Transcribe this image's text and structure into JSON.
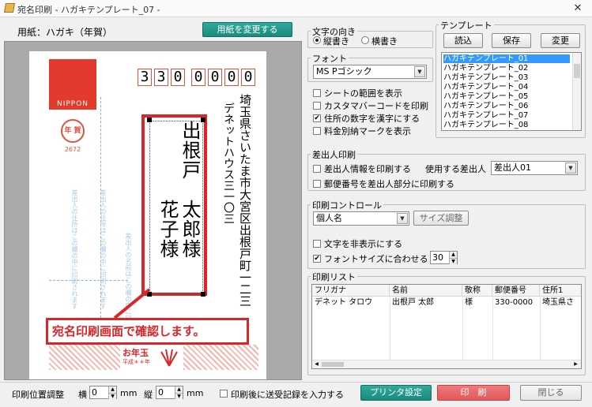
{
  "window": {
    "title": "宛名印刷 - ハガキテンプレート_07 -",
    "close": "✕"
  },
  "paper": {
    "label": "用紙：ハガキ（年賀）",
    "change_btn": "用紙を変更する"
  },
  "card": {
    "brand": "NIPPON",
    "stamp_text": "年 賀",
    "stamp_num": "2672",
    "postal_code": [
      "3",
      "3",
      "0",
      "0",
      "0",
      "0",
      "0"
    ],
    "addr_line1": "埼玉県さいたま市大宮区出根戸町一二三",
    "addr_line2": "デネットハウス三一〇三",
    "name_line1": "出根戸　太郎様",
    "name_line2": "　　　　花子様",
    "faded1": "差出人の住所はこの欄の中に印刷されます",
    "faded2": "差出人の住所はこの欄の中に印刷されます",
    "faded3": "差出人の名前はこの欄の中に印刷されます",
    "callout": "宛名印刷画面で確認します。",
    "otoshidama": "お年玉",
    "otoshidama_sub": "平成＊＊年"
  },
  "direction": {
    "title": "文字の向き",
    "vertical": "縦書き",
    "horizontal": "横書き"
  },
  "font": {
    "title": "フォント",
    "value": "MS Pゴシック"
  },
  "options": [
    {
      "label": "シートの範囲を表示",
      "checked": ""
    },
    {
      "label": "カスタマバーコードを印刷",
      "checked": ""
    },
    {
      "label": "住所の数字を漢字にする",
      "checked": "✔"
    },
    {
      "label": "料金別納マークを表示",
      "checked": ""
    }
  ],
  "template": {
    "title": "テンプレート",
    "load": "読込",
    "save": "保存",
    "change": "変更",
    "items": [
      "ハガキテンプレート_01",
      "ハガキテンプレート_02",
      "ハガキテンプレート_03",
      "ハガキテンプレート_04",
      "ハガキテンプレート_05",
      "ハガキテンプレート_06",
      "ハガキテンプレート_07",
      "ハガキテンプレート_08"
    ]
  },
  "sender": {
    "title": "差出人印刷",
    "print_info": "差出人情報を印刷する",
    "use_label": "使用する差出人",
    "use_value": "差出人01",
    "postal": "郵便番号を差出人部分に印刷する"
  },
  "control": {
    "title": "印刷コントロール",
    "select": "個人名",
    "size_btn": "サイズ調整",
    "hide_text": "文字を非表示にする",
    "fit_font": "フォントサイズに合わせる",
    "fit_checked": "✔",
    "font_size": "30"
  },
  "list": {
    "title": "印刷リスト",
    "headers": [
      "フリガナ",
      "名前",
      "敬称",
      "郵便番号",
      "住所1"
    ],
    "row": [
      "デネット タロウ",
      "出根戸 太郎",
      "様",
      "330-0000",
      "埼玉県さ"
    ]
  },
  "bottom": {
    "pos_label": "印刷位置調整",
    "yoko": "横",
    "tate": "縦",
    "yoko_val": "0",
    "tate_val": "0",
    "mm": "mm",
    "record": "印刷後に送受記録を入力する",
    "printer_btn": "プリンタ設定",
    "print_btn": "印　刷",
    "close_btn": "閉じる"
  },
  "colors": {
    "accent_teal": "#1e9183",
    "stamp_red": "#e0533c",
    "callout_red": "#d9262a",
    "ink_blue": "#4a90c8"
  }
}
